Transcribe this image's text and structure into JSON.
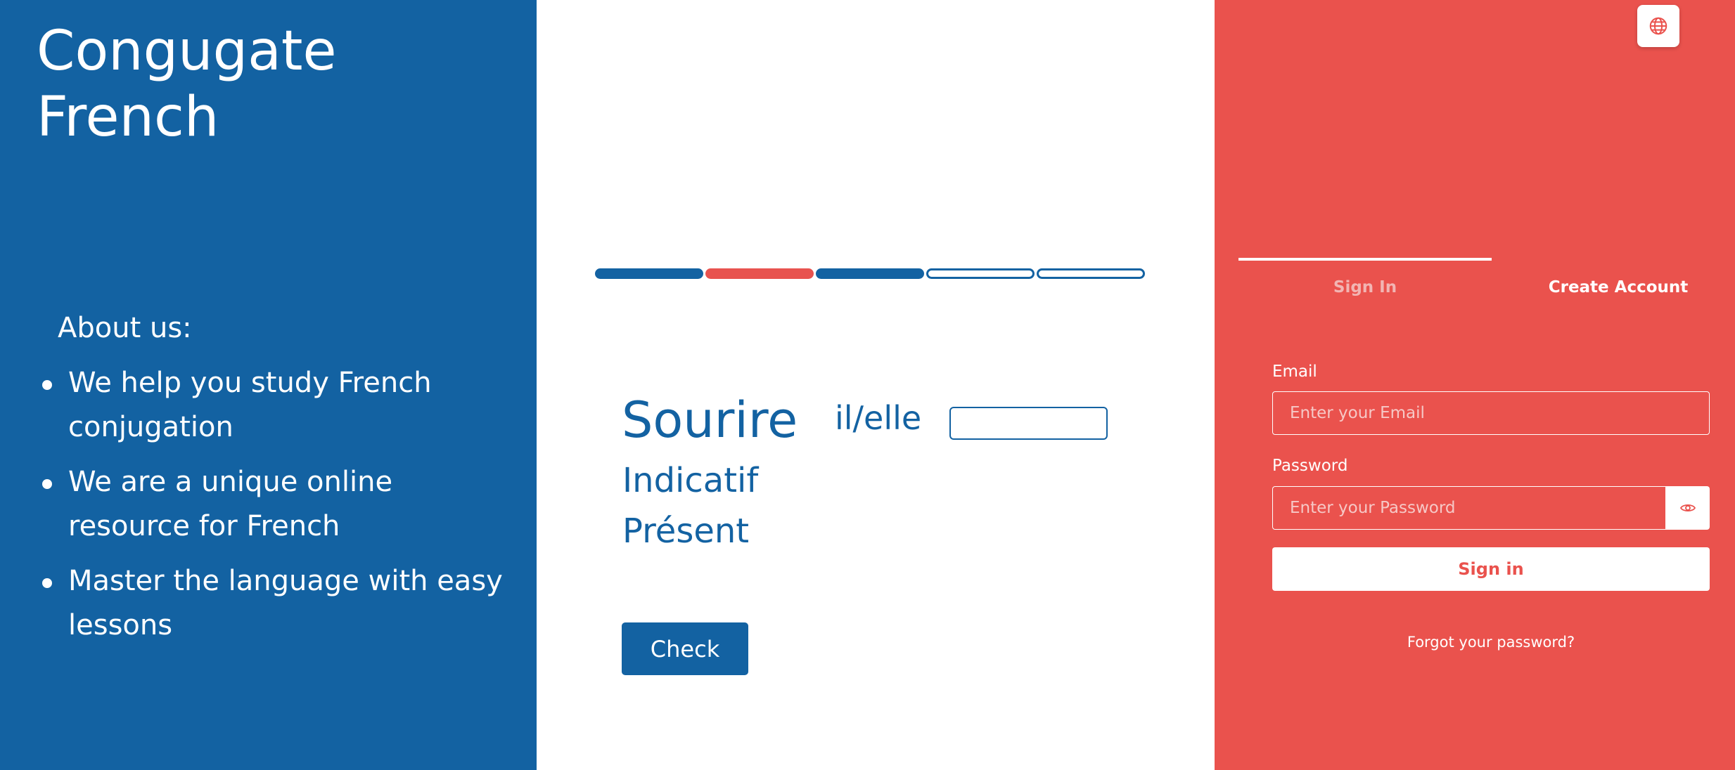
{
  "app": {
    "title": "Congugate French"
  },
  "about": {
    "heading": "About us:",
    "items": [
      "We help you study French conjugation",
      "We are a unique online resource for French",
      "Master the language with easy lessons"
    ]
  },
  "exercise": {
    "progress": [
      "completed",
      "incorrect",
      "completed",
      "pending",
      "pending"
    ],
    "verb": "Sourire",
    "pronoun": "il/elle",
    "answer_value": "",
    "mood": "Indicatif",
    "tense": "Présent",
    "check_label": "Check"
  },
  "auth": {
    "language_icon": "globe-icon",
    "tabs": {
      "sign_in": "Sign In",
      "create_account": "Create Account"
    },
    "email_label": "Email",
    "email_placeholder": "Enter your Email",
    "password_label": "Password",
    "password_placeholder": "Enter your Password",
    "show_password_icon": "eye-icon",
    "sign_in_button": "Sign in",
    "forgot_link": "Forgot your password?"
  },
  "colors": {
    "blue": "#1362a2",
    "red": "#ea524d",
    "white": "#ffffff"
  }
}
